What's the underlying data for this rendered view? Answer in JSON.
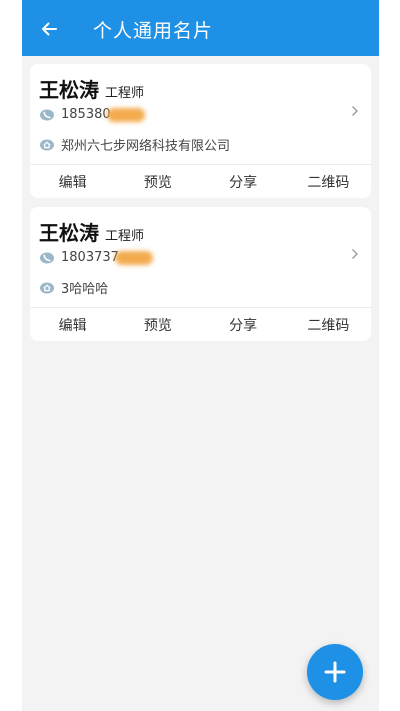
{
  "appbar": {
    "title": "个人通用名片",
    "back_icon": "arrow-left-icon"
  },
  "colors": {
    "primary": "#1e90e6",
    "background": "#f3f3f3",
    "redaction": "#f2a23b"
  },
  "cards": [
    {
      "name": "王松涛",
      "job": "工程师",
      "phone": "185380",
      "address": "郑州六七步网络科技有限公司",
      "actions": [
        "编辑",
        "预览",
        "分享",
        "二维码"
      ]
    },
    {
      "name": "王松涛",
      "job": "工程师",
      "phone": "1803737",
      "address": "3哈哈哈",
      "actions": [
        "编辑",
        "预览",
        "分享",
        "二维码"
      ]
    }
  ],
  "fab": {
    "icon": "plus-icon"
  }
}
